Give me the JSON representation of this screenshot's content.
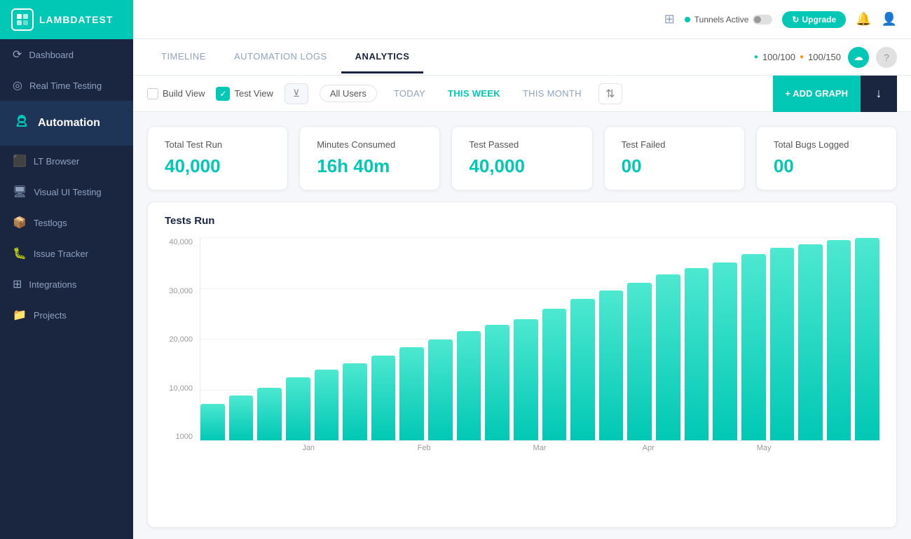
{
  "sidebar": {
    "logo_text": "LAMBDATEST",
    "items": [
      {
        "id": "dashboard",
        "label": "Dashboard",
        "icon": "⟳"
      },
      {
        "id": "realtime",
        "label": "Real Time Testing",
        "icon": "◎"
      },
      {
        "id": "automation",
        "label": "Automation",
        "icon": "🤖",
        "active": true
      },
      {
        "id": "lt-browser",
        "label": "LT Browser",
        "icon": "⬛"
      },
      {
        "id": "visual-ui",
        "label": "Visual UI Testing",
        "icon": "📺"
      },
      {
        "id": "testlogs",
        "label": "Testlogs",
        "icon": "📦"
      },
      {
        "id": "issue-tracker",
        "label": "Issue Tracker",
        "icon": "🐛"
      },
      {
        "id": "integrations",
        "label": "Integrations",
        "icon": "⊞"
      },
      {
        "id": "projects",
        "label": "Projects",
        "icon": "📁"
      }
    ]
  },
  "header": {
    "tunnels_label": "Tunnels Active",
    "upgrade_label": "Upgrade",
    "credits_1": "100/100",
    "credits_2": "100/150"
  },
  "tabs": [
    {
      "id": "timeline",
      "label": "TIMELINE",
      "active": false
    },
    {
      "id": "automation-logs",
      "label": "AUTOMATION LOGS",
      "active": false
    },
    {
      "id": "analytics",
      "label": "ANALYTICS",
      "active": true
    }
  ],
  "filters": {
    "build_view": "Build View",
    "test_view": "Test View",
    "all_users": "All Users",
    "today": "TODAY",
    "this_week": "THIS WEEK",
    "this_month": "THIS MONTH",
    "add_graph": "+ ADD GRAPH"
  },
  "stats": [
    {
      "label": "Total Test Run",
      "value": "40,000"
    },
    {
      "label": "Minutes Consumed",
      "value": "16h 40m"
    },
    {
      "label": "Test Passed",
      "value": "40,000"
    },
    {
      "label": "Test Failed",
      "value": "00"
    },
    {
      "label": "Total Bugs Logged",
      "value": "00"
    }
  ],
  "chart": {
    "title": "Tests Run",
    "y_labels": [
      "40,000",
      "30,000",
      "20,000",
      "10,000",
      "1000"
    ],
    "bars": [
      {
        "month": "",
        "height_pct": 18
      },
      {
        "month": "",
        "height_pct": 22
      },
      {
        "month": "",
        "height_pct": 26
      },
      {
        "month": "",
        "height_pct": 31
      },
      {
        "month": "Jan",
        "height_pct": 35
      },
      {
        "month": "",
        "height_pct": 38
      },
      {
        "month": "",
        "height_pct": 42
      },
      {
        "month": "",
        "height_pct": 46
      },
      {
        "month": "Feb",
        "height_pct": 50
      },
      {
        "month": "",
        "height_pct": 54
      },
      {
        "month": "",
        "height_pct": 57
      },
      {
        "month": "Mar",
        "height_pct": 60
      },
      {
        "month": "",
        "height_pct": 65
      },
      {
        "month": "",
        "height_pct": 70
      },
      {
        "month": "Apr",
        "height_pct": 74
      },
      {
        "month": "",
        "height_pct": 78
      },
      {
        "month": "",
        "height_pct": 82
      },
      {
        "month": "",
        "height_pct": 85
      },
      {
        "month": "",
        "height_pct": 88
      },
      {
        "month": "May",
        "height_pct": 92
      },
      {
        "month": "",
        "height_pct": 95
      },
      {
        "month": "",
        "height_pct": 97
      },
      {
        "month": "",
        "height_pct": 99
      },
      {
        "month": "",
        "height_pct": 100
      }
    ],
    "x_month_labels": [
      {
        "label": "Jan",
        "position_pct": 16
      },
      {
        "label": "Feb",
        "position_pct": 33
      },
      {
        "label": "Mar",
        "position_pct": 50
      },
      {
        "label": "Apr",
        "position_pct": 66
      },
      {
        "label": "May",
        "position_pct": 83
      }
    ]
  }
}
